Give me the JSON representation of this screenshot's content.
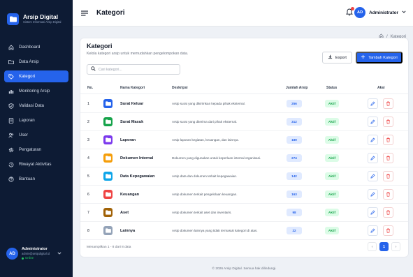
{
  "brand": {
    "title": "Arsip Digital",
    "subtitle": "Sistem Informasi Arsip Digital"
  },
  "nav": [
    {
      "label": "Dashboard",
      "icon": "home-icon",
      "active": false
    },
    {
      "label": "Data Arsip",
      "icon": "folder-icon",
      "active": false
    },
    {
      "label": "Kategori",
      "icon": "tag-icon",
      "active": true
    },
    {
      "label": "Monitoring Arsip",
      "icon": "chart-icon",
      "active": false
    },
    {
      "label": "Validasi Data",
      "icon": "check-shield-icon",
      "active": false
    },
    {
      "label": "Laporan",
      "icon": "report-icon",
      "active": false
    },
    {
      "label": "User",
      "icon": "users-icon",
      "active": false
    },
    {
      "label": "Pengaturan",
      "icon": "gear-icon",
      "active": false
    },
    {
      "label": "Riwayat Aktivitas",
      "icon": "history-icon",
      "active": false
    },
    {
      "label": "Bantuan",
      "icon": "help-icon",
      "active": false
    }
  ],
  "profile": {
    "initials": "AD",
    "name": "Administrator",
    "email": "admin@arsipdigital.id",
    "status": "Online"
  },
  "topbar": {
    "title": "Kategori",
    "user_initials": "AD",
    "user_name": "Administrator"
  },
  "breadcrumb": {
    "separator": "/",
    "current": "Kategori"
  },
  "card": {
    "title": "Kategori",
    "subtitle": "Kelola kategori arsip untuk memudahkan pengelompokan data.",
    "export_label": "Export",
    "add_label": "Tambah Kategori",
    "search_placeholder": "Cari kategori..."
  },
  "table": {
    "headers": {
      "no": "No.",
      "name": "Nama Kategori",
      "desc": "Deskripsi",
      "count": "Jumlah Arsip",
      "status": "Status",
      "action": "Aksi"
    },
    "rows": [
      {
        "no": "1",
        "name": "Surat Keluar",
        "desc": "Arsip surat yang dikirimkan kepada pihak eksternal.",
        "count": "256",
        "status": "Aktif",
        "color": "#2563eb"
      },
      {
        "no": "2",
        "name": "Surat Masuk",
        "desc": "Arsip surat yang diterima dari pihak eksternal.",
        "count": "312",
        "status": "Aktif",
        "color": "#16a34a"
      },
      {
        "no": "3",
        "name": "Laporan",
        "desc": "Arsip laporan kegiatan, keuangan, dan lainnya.",
        "count": "189",
        "status": "Aktif",
        "color": "#7c3aed"
      },
      {
        "no": "4",
        "name": "Dokumen Internal",
        "desc": "Dokumen yang digunakan untuk keperluan internal organisasi.",
        "count": "274",
        "status": "Aktif",
        "color": "#f59e0b"
      },
      {
        "no": "5",
        "name": "Data Kepegawaian",
        "desc": "Arsip data dan dokumen terkait kepegawaian.",
        "count": "142",
        "status": "Aktif",
        "color": "#0ea5e9"
      },
      {
        "no": "6",
        "name": "Keuangan",
        "desc": "Arsip dokumen terkait pengelolaan keuangan.",
        "count": "163",
        "status": "Aktif",
        "color": "#ef4444"
      },
      {
        "no": "7",
        "name": "Aset",
        "desc": "Arsip dokumen terkait aset dan inventaris.",
        "count": "98",
        "status": "Aktif",
        "color": "#a16207"
      },
      {
        "no": "8",
        "name": "Lainnya",
        "desc": "Arsip dokumen lainnya yang tidak termasuk kategori di atas.",
        "count": "22",
        "status": "Aktif",
        "color": "#94a3b8"
      }
    ]
  },
  "footer": {
    "info": "Menampilkan 1 - 8 dari 8 data",
    "page": "1",
    "prev": "‹",
    "next": "›",
    "copyright": "© 2026 Arsip Digital. Semua hak dilindungi."
  }
}
